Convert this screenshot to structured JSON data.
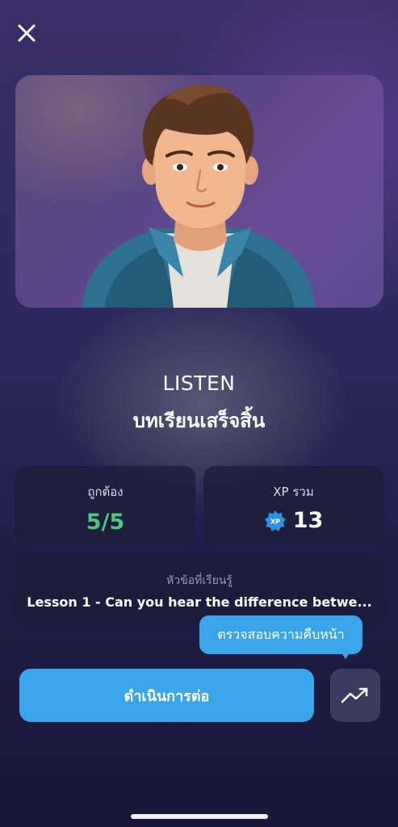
{
  "header": {
    "close_icon": "close-icon"
  },
  "hero": {
    "image": "avatar-illustration"
  },
  "result": {
    "mode": "LISTEN",
    "status": "บทเรียนเสร็จสิ้น"
  },
  "stats": {
    "correct_label": "ถูกต้อง",
    "correct_value": "5/5",
    "xp_label": "XP รวม",
    "xp_badge": "XP",
    "xp_value": "13"
  },
  "topic": {
    "label": "หัวข้อที่เรียนรู้",
    "value": "Lesson 1 - Can you hear the difference betwe..."
  },
  "tooltip": {
    "text": "ตรวจสอบความคืบหน้า"
  },
  "actions": {
    "continue_label": "ดำเนินการต่อ",
    "progress_icon": "trending-up-icon"
  },
  "colors": {
    "accent": "#3aa5e8",
    "success": "#4cc77f",
    "card_bg": "#1c1e3a"
  }
}
